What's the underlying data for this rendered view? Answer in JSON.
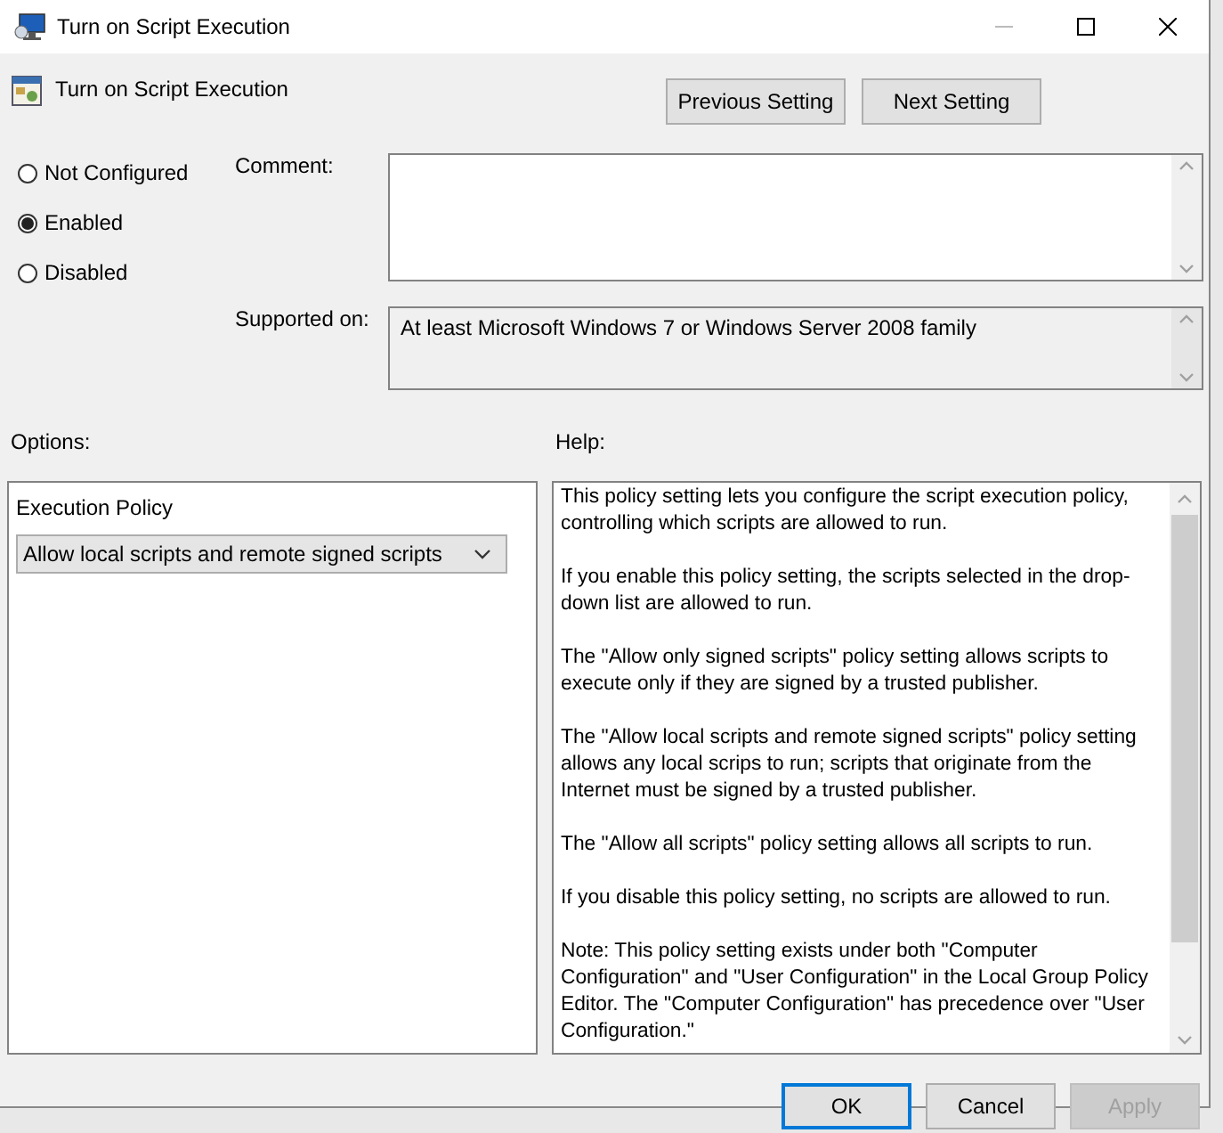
{
  "window": {
    "title": "Turn on Script Execution"
  },
  "header": {
    "title": "Turn on Script Execution"
  },
  "nav_buttons": [
    "Previous Setting",
    "Next Setting"
  ],
  "state_options": [
    {
      "label": "Not Configured",
      "selected": false
    },
    {
      "label": "Enabled",
      "selected": true
    },
    {
      "label": "Disabled",
      "selected": false
    }
  ],
  "comment": {
    "label": "Comment:"
  },
  "supported_on": {
    "label": "Supported on:",
    "value": "At least Microsoft Windows 7 or Windows Server 2008 family"
  },
  "options": {
    "label": "Options:",
    "policy_label": "Execution Policy",
    "dropdown": {
      "value": "Allow local scripts and remote signed scripts"
    }
  },
  "help": {
    "label": "Help:",
    "paragraphs": [
      "This policy setting lets you configure the script execution policy, controlling which scripts are allowed to run.",
      "If you enable this policy setting, the scripts selected in the drop-down list are allowed to run.",
      "The \"Allow only signed scripts\" policy setting allows scripts to execute only if they are signed by a trusted publisher.",
      "The \"Allow local scripts and remote signed scripts\" policy setting allows any local scrips to run; scripts that originate from the Internet must be signed by a trusted publisher.",
      "The \"Allow all scripts\" policy setting allows all scripts to run.",
      "If you disable this policy setting, no scripts are allowed to run.",
      "Note: This policy setting exists under both \"Computer Configuration\" and \"User Configuration\" in the Local Group Policy Editor. The \"Computer Configuration\" has precedence over \"User Configuration.\""
    ]
  },
  "buttons": [
    {
      "label": "OK",
      "kind": "default",
      "disabled": false
    },
    {
      "label": "Cancel",
      "kind": "normal",
      "disabled": false
    },
    {
      "label": "Apply",
      "kind": "normal",
      "disabled": true
    }
  ]
}
